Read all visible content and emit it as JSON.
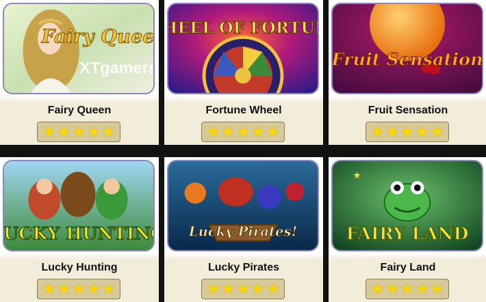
{
  "games": [
    {
      "title": "Fairy Queen",
      "logo": "Fairy Queen",
      "rating": 5
    },
    {
      "title": "Fortune Wheel",
      "logo": "WHEEL OF FORTUNE",
      "rating": 5
    },
    {
      "title": "Fruit Sensation",
      "logo": "Fruit Sensation",
      "rating": 5
    },
    {
      "title": "Lucky Hunting",
      "logo": "LUCKY HUNTING",
      "rating": 5
    },
    {
      "title": "Lucky Pirates",
      "logo": "Lucky Pirates!",
      "rating": 5
    },
    {
      "title": "Fairy Land",
      "logo": "FAIRY LAND",
      "rating": 5
    }
  ],
  "watermark": "XTgamers",
  "colors": {
    "star": "#ffd800",
    "rating_bg": "#d6c99a",
    "thumb_border": "#8c84c4"
  }
}
